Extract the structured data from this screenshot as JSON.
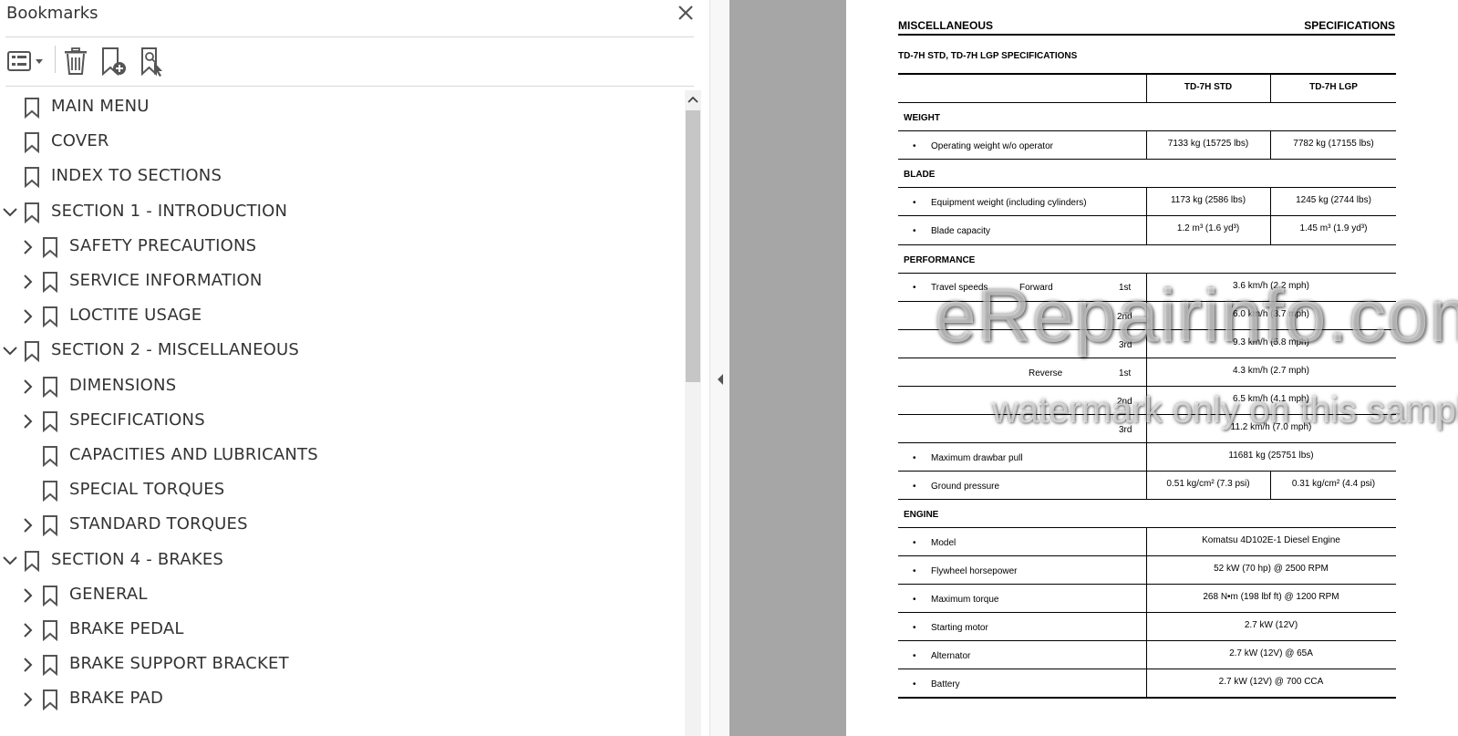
{
  "panel": {
    "title": "Bookmarks"
  },
  "toolbar": {
    "icons": [
      "bookmark-options-icon",
      "delete-bookmark-icon",
      "new-bookmark-icon",
      "find-current-bookmark-icon"
    ]
  },
  "bookmarks": [
    {
      "label": "MAIN MENU",
      "level": 0,
      "chevron": "none"
    },
    {
      "label": "COVER",
      "level": 0,
      "chevron": "none"
    },
    {
      "label": "INDEX TO SECTIONS",
      "level": 0,
      "chevron": "none"
    },
    {
      "label": "SECTION 1 - INTRODUCTION",
      "level": 0,
      "chevron": "down"
    },
    {
      "label": "SAFETY PRECAUTIONS",
      "level": 1,
      "chevron": "right"
    },
    {
      "label": "SERVICE INFORMATION",
      "level": 1,
      "chevron": "right"
    },
    {
      "label": "LOCTITE USAGE",
      "level": 1,
      "chevron": "right"
    },
    {
      "label": "SECTION 2 - MISCELLANEOUS",
      "level": 0,
      "chevron": "down"
    },
    {
      "label": "DIMENSIONS",
      "level": 1,
      "chevron": "right"
    },
    {
      "label": "SPECIFICATIONS",
      "level": 1,
      "chevron": "right"
    },
    {
      "label": "CAPACITIES AND LUBRICANTS",
      "level": 1,
      "chevron": "none"
    },
    {
      "label": "SPECIAL TORQUES",
      "level": 1,
      "chevron": "none"
    },
    {
      "label": "STANDARD TORQUES",
      "level": 1,
      "chevron": "right"
    },
    {
      "label": "SECTION 4 - BRAKES",
      "level": 0,
      "chevron": "down"
    },
    {
      "label": "GENERAL",
      "level": 1,
      "chevron": "right"
    },
    {
      "label": "BRAKE PEDAL",
      "level": 1,
      "chevron": "right"
    },
    {
      "label": "BRAKE SUPPORT BRACKET",
      "level": 1,
      "chevron": "right"
    },
    {
      "label": "BRAKE PAD",
      "level": 1,
      "chevron": "right"
    }
  ],
  "document": {
    "header_left": "MISCELLANEOUS",
    "header_right": "SPECIFICATIONS",
    "subtitle": "TD-7H STD, TD-7H LGP SPECIFICATIONS",
    "col_std": "TD-7H STD",
    "col_lgp": "TD-7H LGP",
    "bullet": "•",
    "weight": {
      "heading": "WEIGHT",
      "op_label": "Operating weight w/o operator",
      "op_std": "7133 kg  (15725 lbs)",
      "op_lgp": "7782 kg  (17155 lbs)"
    },
    "blade": {
      "heading": "BLADE",
      "eq_label": "Equipment weight (including cylinders)",
      "eq_std": "1173 kg  (2586 lbs)",
      "eq_lgp": "1245 kg  (2744 lbs)",
      "cap_label": "Blade capacity",
      "cap_std": "1.2 m³  (1.6 yd³)",
      "cap_lgp": "1.45 m³  (1.9 yd³)"
    },
    "performance": {
      "heading": "PERFORMANCE",
      "travel_label": "Travel speeds",
      "forward_label": "Forward",
      "reverse_label": "Reverse",
      "gears": [
        "1st",
        "2nd",
        "3rd",
        "1st",
        "2nd",
        "3rd"
      ],
      "speeds": [
        "3.6 km/h  (2.2 mph)",
        "6.0 km/h  (3.7 mph)",
        "9.3 km/h  (5.8 mph)",
        "4.3 km/h  (2.7 mph)",
        "6.5 km/h  (4.1 mph)",
        "11.2 km/h  (7.0 mph)"
      ],
      "drawbar_label": "Maximum drawbar pull",
      "drawbar_value": "11681 kg  (25751 lbs)",
      "ground_label": "Ground pressure",
      "ground_std": "0.51 kg/cm²  (7.3 psi)",
      "ground_lgp": "0.31 kg/cm²  (4.4 psi)"
    },
    "engine": {
      "heading": "ENGINE",
      "rows": [
        {
          "label": "Model",
          "value": "Komatsu 4D102E-1 Diesel Engine"
        },
        {
          "label": "Flywheel horsepower",
          "value": "52 kW  (70 hp) @ 2500 RPM"
        },
        {
          "label": "Maximum torque",
          "value": "268 N•m  (198 lbf ft) @ 1200 RPM"
        },
        {
          "label": "Starting motor",
          "value": "2.7 kW  (12V)"
        },
        {
          "label": "Alternator",
          "value": "2.7 kW  (12V) @ 65A"
        },
        {
          "label": "Battery",
          "value": "2.7 kW  (12V) @ 700 CCA"
        }
      ]
    },
    "watermark_line1": "eRepairinfo.com",
    "watermark_line2": "watermark only on this sample"
  }
}
